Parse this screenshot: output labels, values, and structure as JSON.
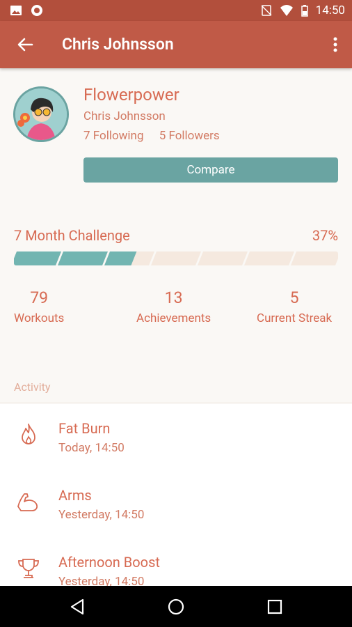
{
  "status": {
    "time": "14:50"
  },
  "appbar": {
    "title": "Chris Johnsson"
  },
  "profile": {
    "username": "Flowerpower",
    "real_name": "Chris Johnsson",
    "following": "7 Following",
    "followers": "5 Followers",
    "compare_label": "Compare"
  },
  "challenge": {
    "title": "7 Month Challenge",
    "percent_label": "37%",
    "progress": 0.37,
    "segments": 7,
    "fill_color": "#72b5b1",
    "empty_color": "#f5e9df"
  },
  "stats": [
    {
      "value": "79",
      "label": "Workouts"
    },
    {
      "value": "13",
      "label": "Achievements"
    },
    {
      "value": "5",
      "label": "Current Streak"
    }
  ],
  "activity": {
    "heading": "Activity",
    "items": [
      {
        "name": "Fat Burn",
        "time": "Today, 14:50",
        "icon": "flame-icon"
      },
      {
        "name": "Arms",
        "time": "Yesterday, 14:50",
        "icon": "bicep-icon"
      },
      {
        "name": "Afternoon Boost",
        "time": "Yesterday, 14:50",
        "icon": "trophy-icon"
      }
    ]
  },
  "colors": {
    "accent": "#c05a47",
    "teal": "#6aa4a2",
    "text_accent": "#d76a52"
  }
}
